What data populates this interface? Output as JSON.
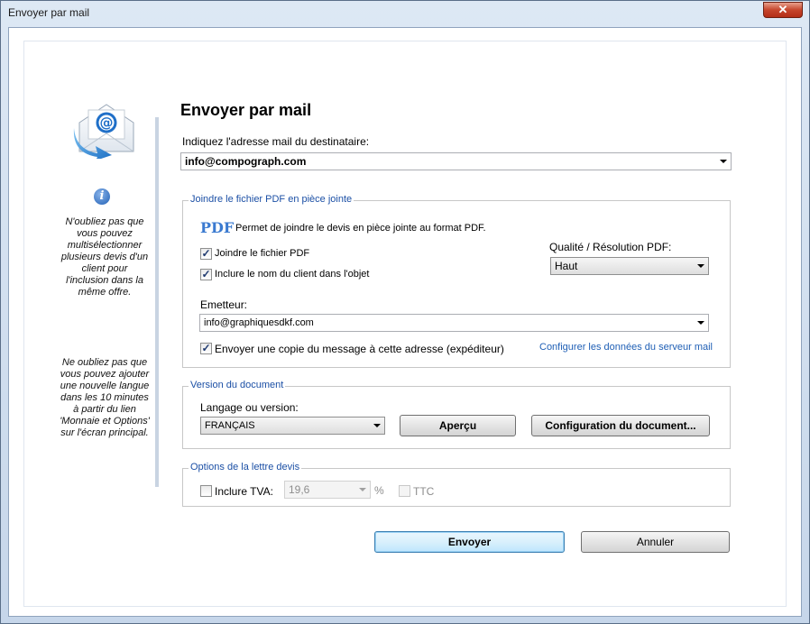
{
  "window": {
    "title": "Envoyer par mail",
    "close_symbol": "✕"
  },
  "sidebar": {
    "note1": "N'oubliez pas que vous pouvez multisélectionner plusieurs devis d'un client pour l'inclusion dans la même offre.",
    "note2": "Ne oubliez pas que vous pouvez ajouter une nouvelle langue dans les 10 minutes à partir du lien 'Monnaie et Options' sur l'écran principal."
  },
  "main": {
    "heading": "Envoyer par mail",
    "recipient_label": "Indiquez l'adresse mail du destinataire:",
    "recipient_value": "info@compograph.com"
  },
  "attach_group": {
    "title": "Joindre le fichier PDF en pièce jointe",
    "pdf_label": "PDF",
    "pdf_desc": "Permet de joindre le devis en pièce jointe au format PDF.",
    "attach_pdf_label": "Joindre le fichier PDF",
    "attach_pdf_checked": true,
    "include_client_label": "Inclure le nom du client dans l'objet",
    "include_client_checked": true,
    "quality_label": "Qualité / Résolution PDF:",
    "quality_value": "Haut",
    "sender_label": "Emetteur:",
    "sender_value": "info@graphiquesdkf.com",
    "copy_label": "Envoyer une copie du message à cette adresse (expéditeur)",
    "copy_checked": true,
    "server_link": "Configurer les données du serveur mail"
  },
  "version_group": {
    "title": "Version du document",
    "language_label": "Langage ou version:",
    "language_value": "FRANÇAIS",
    "preview_button": "Aperçu",
    "config_button": "Configuration du document..."
  },
  "options_group": {
    "title": "Options de la lettre devis",
    "tva_label": "Inclure TVA:",
    "tva_checked": false,
    "tva_value": "19,6",
    "percent": "%",
    "ttc_label": "TTC",
    "ttc_checked": false
  },
  "actions": {
    "send": "Envoyer",
    "cancel": "Annuler"
  },
  "colors": {
    "group_title": "#1b4fa5",
    "link": "#1f5fb5",
    "close": "#c6452c"
  }
}
